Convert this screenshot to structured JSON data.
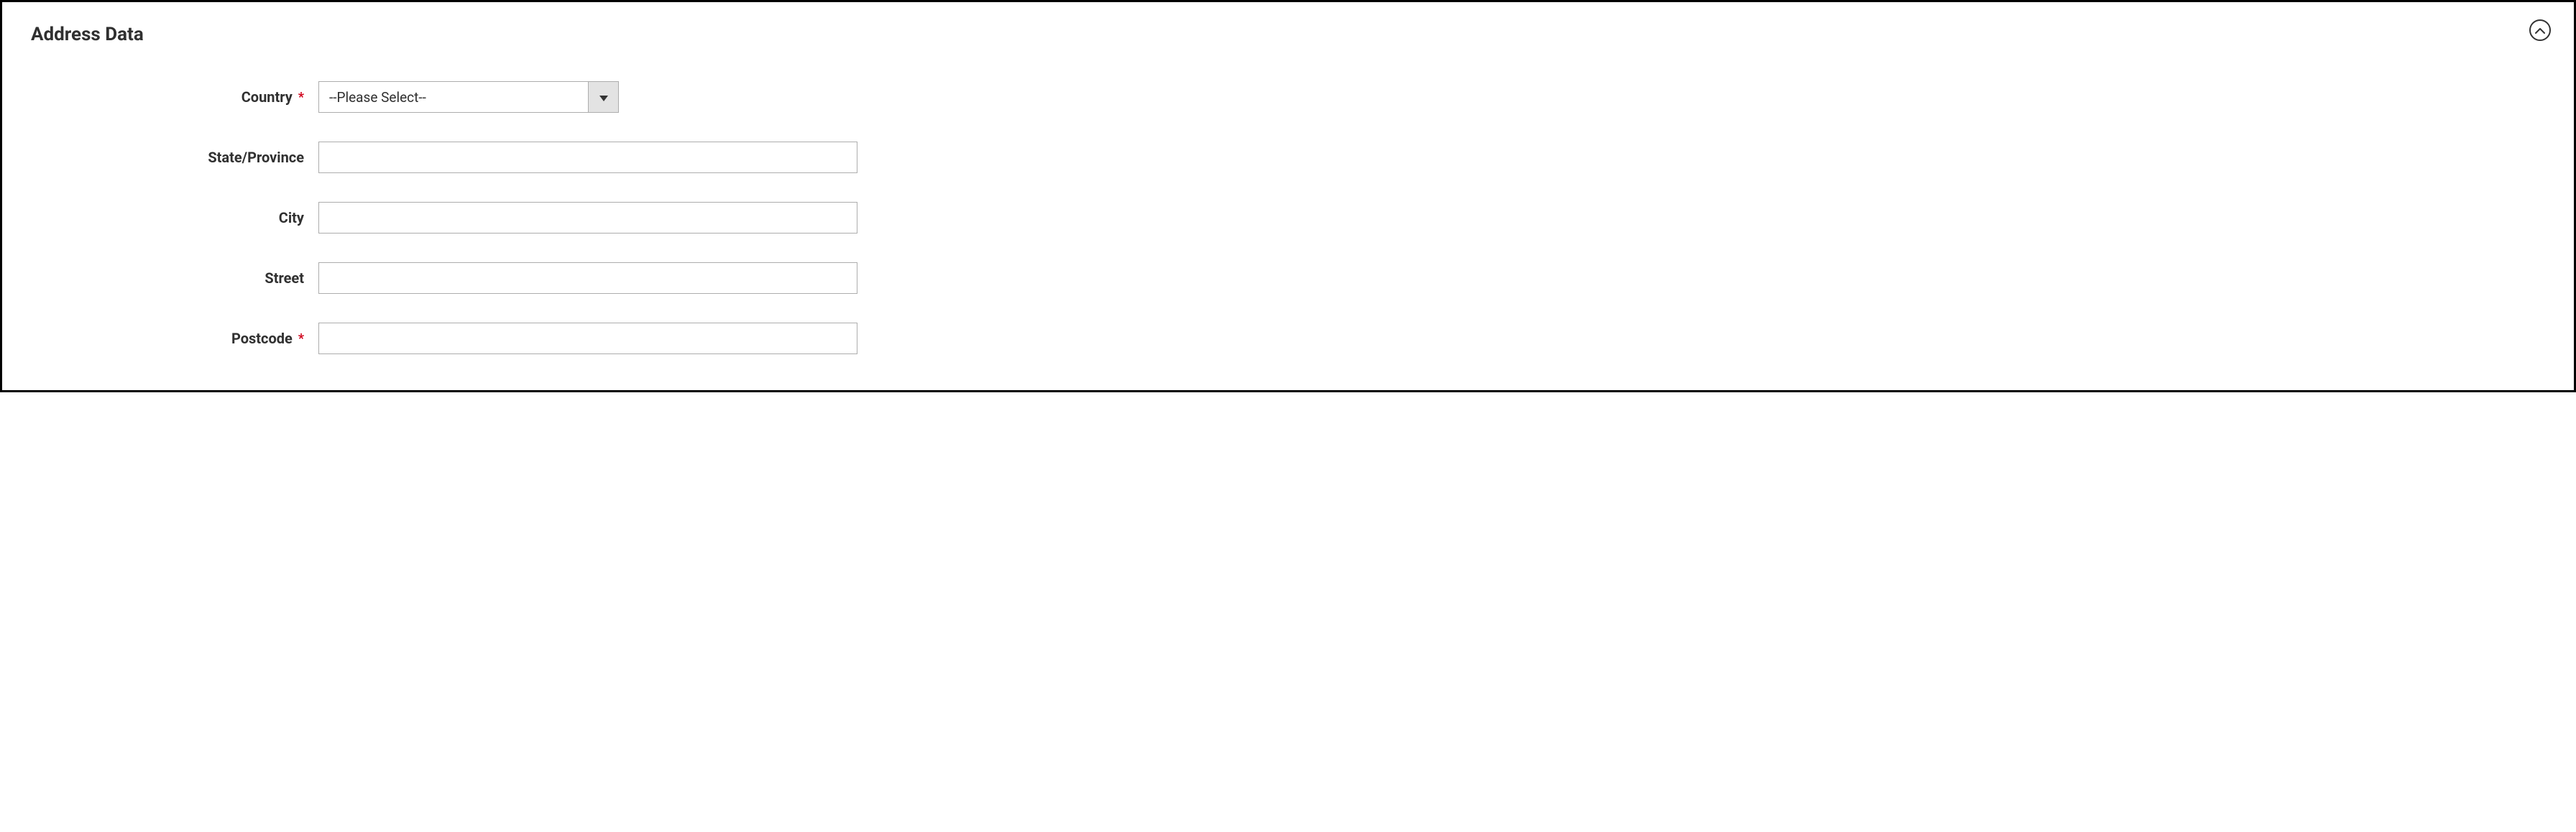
{
  "panel": {
    "title": "Address Data"
  },
  "fields": {
    "country": {
      "label": "Country",
      "required": true,
      "selected": "--Please Select--"
    },
    "state": {
      "label": "State/Province",
      "required": false,
      "value": ""
    },
    "city": {
      "label": "City",
      "required": false,
      "value": ""
    },
    "street": {
      "label": "Street",
      "required": false,
      "value": ""
    },
    "postcode": {
      "label": "Postcode",
      "required": true,
      "value": ""
    }
  },
  "required_mark": "*"
}
